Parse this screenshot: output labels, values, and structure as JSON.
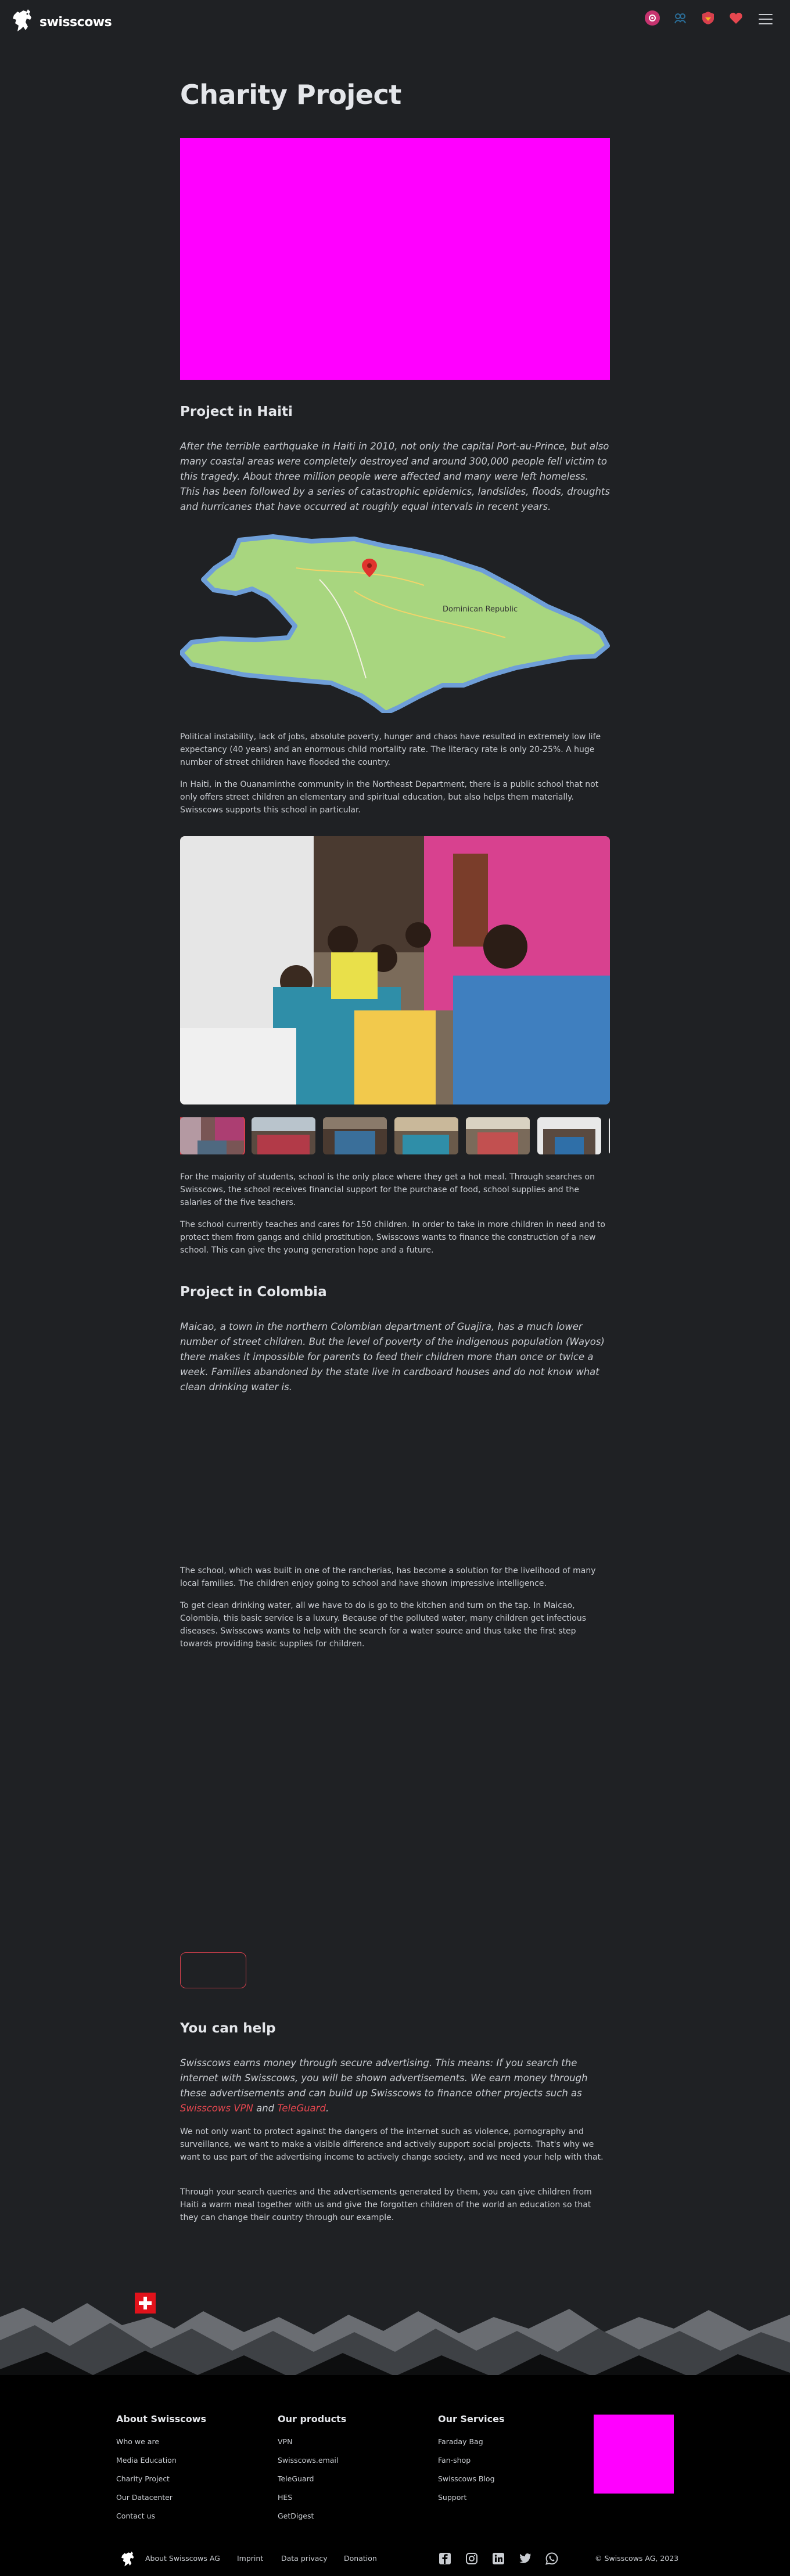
{
  "brand": {
    "name": "swisscows"
  },
  "header": {
    "icons": [
      "email-icon",
      "teleguard-icon",
      "vpn-icon",
      "heart-icon"
    ],
    "colors": {
      "email": "#c6336f",
      "teleguard": "#2b6f9a",
      "vpn": "#d7404d",
      "heart": "#e5474f"
    }
  },
  "page": {
    "title": "Charity Project"
  },
  "haiti": {
    "heading": "Project in Haiti",
    "lead": "After the terrible earthquake in Haiti in 2010, not only the capital Port-au-Prince, but also many coastal areas were completely destroyed and around 300,000 people fell victim to this tragedy. About three million people were affected and many were left homeless. This has been followed by a series of catastrophic epidemics, landslides, floods, droughts and hurricanes that have occurred at roughly equal intervals in recent years.",
    "map": {
      "label": "Dominican Republic",
      "pin_color": "#e0342e"
    },
    "p1": "Political instability, lack of jobs, absolute poverty, hunger and chaos have resulted in extremely low life expectancy (40 years) and an enormous child mortality rate. The literacy rate is only 20-25%. A huge number of street children have flooded the country.",
    "p2": "In Haiti, in the Ouanaminthe community in the Northeast Department, there is a public school that not only offers street children an elementary and spiritual education, but also helps them materially. Swisscows supports this school in particular.",
    "p3": "For the majority of students, school is the only place where they get a hot meal. Through searches on Swisscows, the school receives financial support for the purchase of food, school supplies and the salaries of the five teachers.",
    "p4": "The school currently teaches and cares for 150 children. In order to take in more children in need and to protect them from gangs and child prostitution, Swisscows wants to finance the construction of a new school. This can give the young generation hope and a future."
  },
  "colombia": {
    "heading": "Project in Colombia",
    "lead": "Maicao, a town in the northern Colombian department of Guajira, has a much lower number of street children. But the level of poverty of the indigenous population (Wayos) there makes it impossible for parents to feed their children more than once or twice a week. Families abandoned by the state live in cardboard houses and do not know what clean drinking water is.",
    "p1": "The school, which was built in one of the rancherias, has become a solution for the livelihood of many local families. The children enjoy going to school and have shown impressive intelligence.",
    "p2": "To get clean drinking water, all we have to do is go to the kitchen and turn on the tap. In Maicao, Colombia, this basic service is a luxury. Because of the polluted water, many children get infectious diseases. Swisscows wants to help with the search for a water source and thus take the first step towards providing basic supplies for children."
  },
  "help": {
    "heading": "You can help",
    "lead_before": "Swisscows earns money through secure advertising. This means: If you search the internet with Swisscows, you will be shown advertisements. We earn money through these advertisements and can build up Swisscows to finance other projects such as ",
    "link_vpn": "Swisscows VPN",
    "lead_mid": " and ",
    "link_teleguard": "TeleGuard",
    "lead_after": ".",
    "p1": "We not only want to protect against the dangers of the internet such as violence, pornography and surveillance, we want to make a visible difference and actively support social projects. That's why we want to use part of the advertising income to actively change society, and we need your help with that.",
    "p2": "Through your search queries and the advertisements generated by them, you can give children from Haiti a warm meal together with us and give the forgotten children of the world an education so that they can change their country through our example."
  },
  "footer": {
    "about": {
      "title": "About Swisscows",
      "links": [
        "Who we are",
        "Media Education",
        "Charity Project",
        "Our Datacenter",
        "Contact us"
      ]
    },
    "products": {
      "title": "Our products",
      "links": [
        "VPN",
        "Swisscows.email",
        "TeleGuard",
        "HES",
        "GetDigest"
      ]
    },
    "services": {
      "title": "Our Services",
      "links": [
        "Faraday Bag",
        "Fan-shop",
        "Swisscows Blog",
        "Support"
      ]
    },
    "bottom_links": [
      "About Swisscows AG",
      "Imprint",
      "Data privacy",
      "Donation"
    ],
    "socials": [
      "facebook-icon",
      "instagram-icon",
      "linkedin-icon",
      "twitter-icon",
      "whatsapp-icon"
    ],
    "copyright": "© Swisscows AG, 2023"
  },
  "colors": {
    "background": "#1f2124",
    "accent": "#d7404d",
    "placeholder": "#ff00ff",
    "footer": "#000000"
  }
}
